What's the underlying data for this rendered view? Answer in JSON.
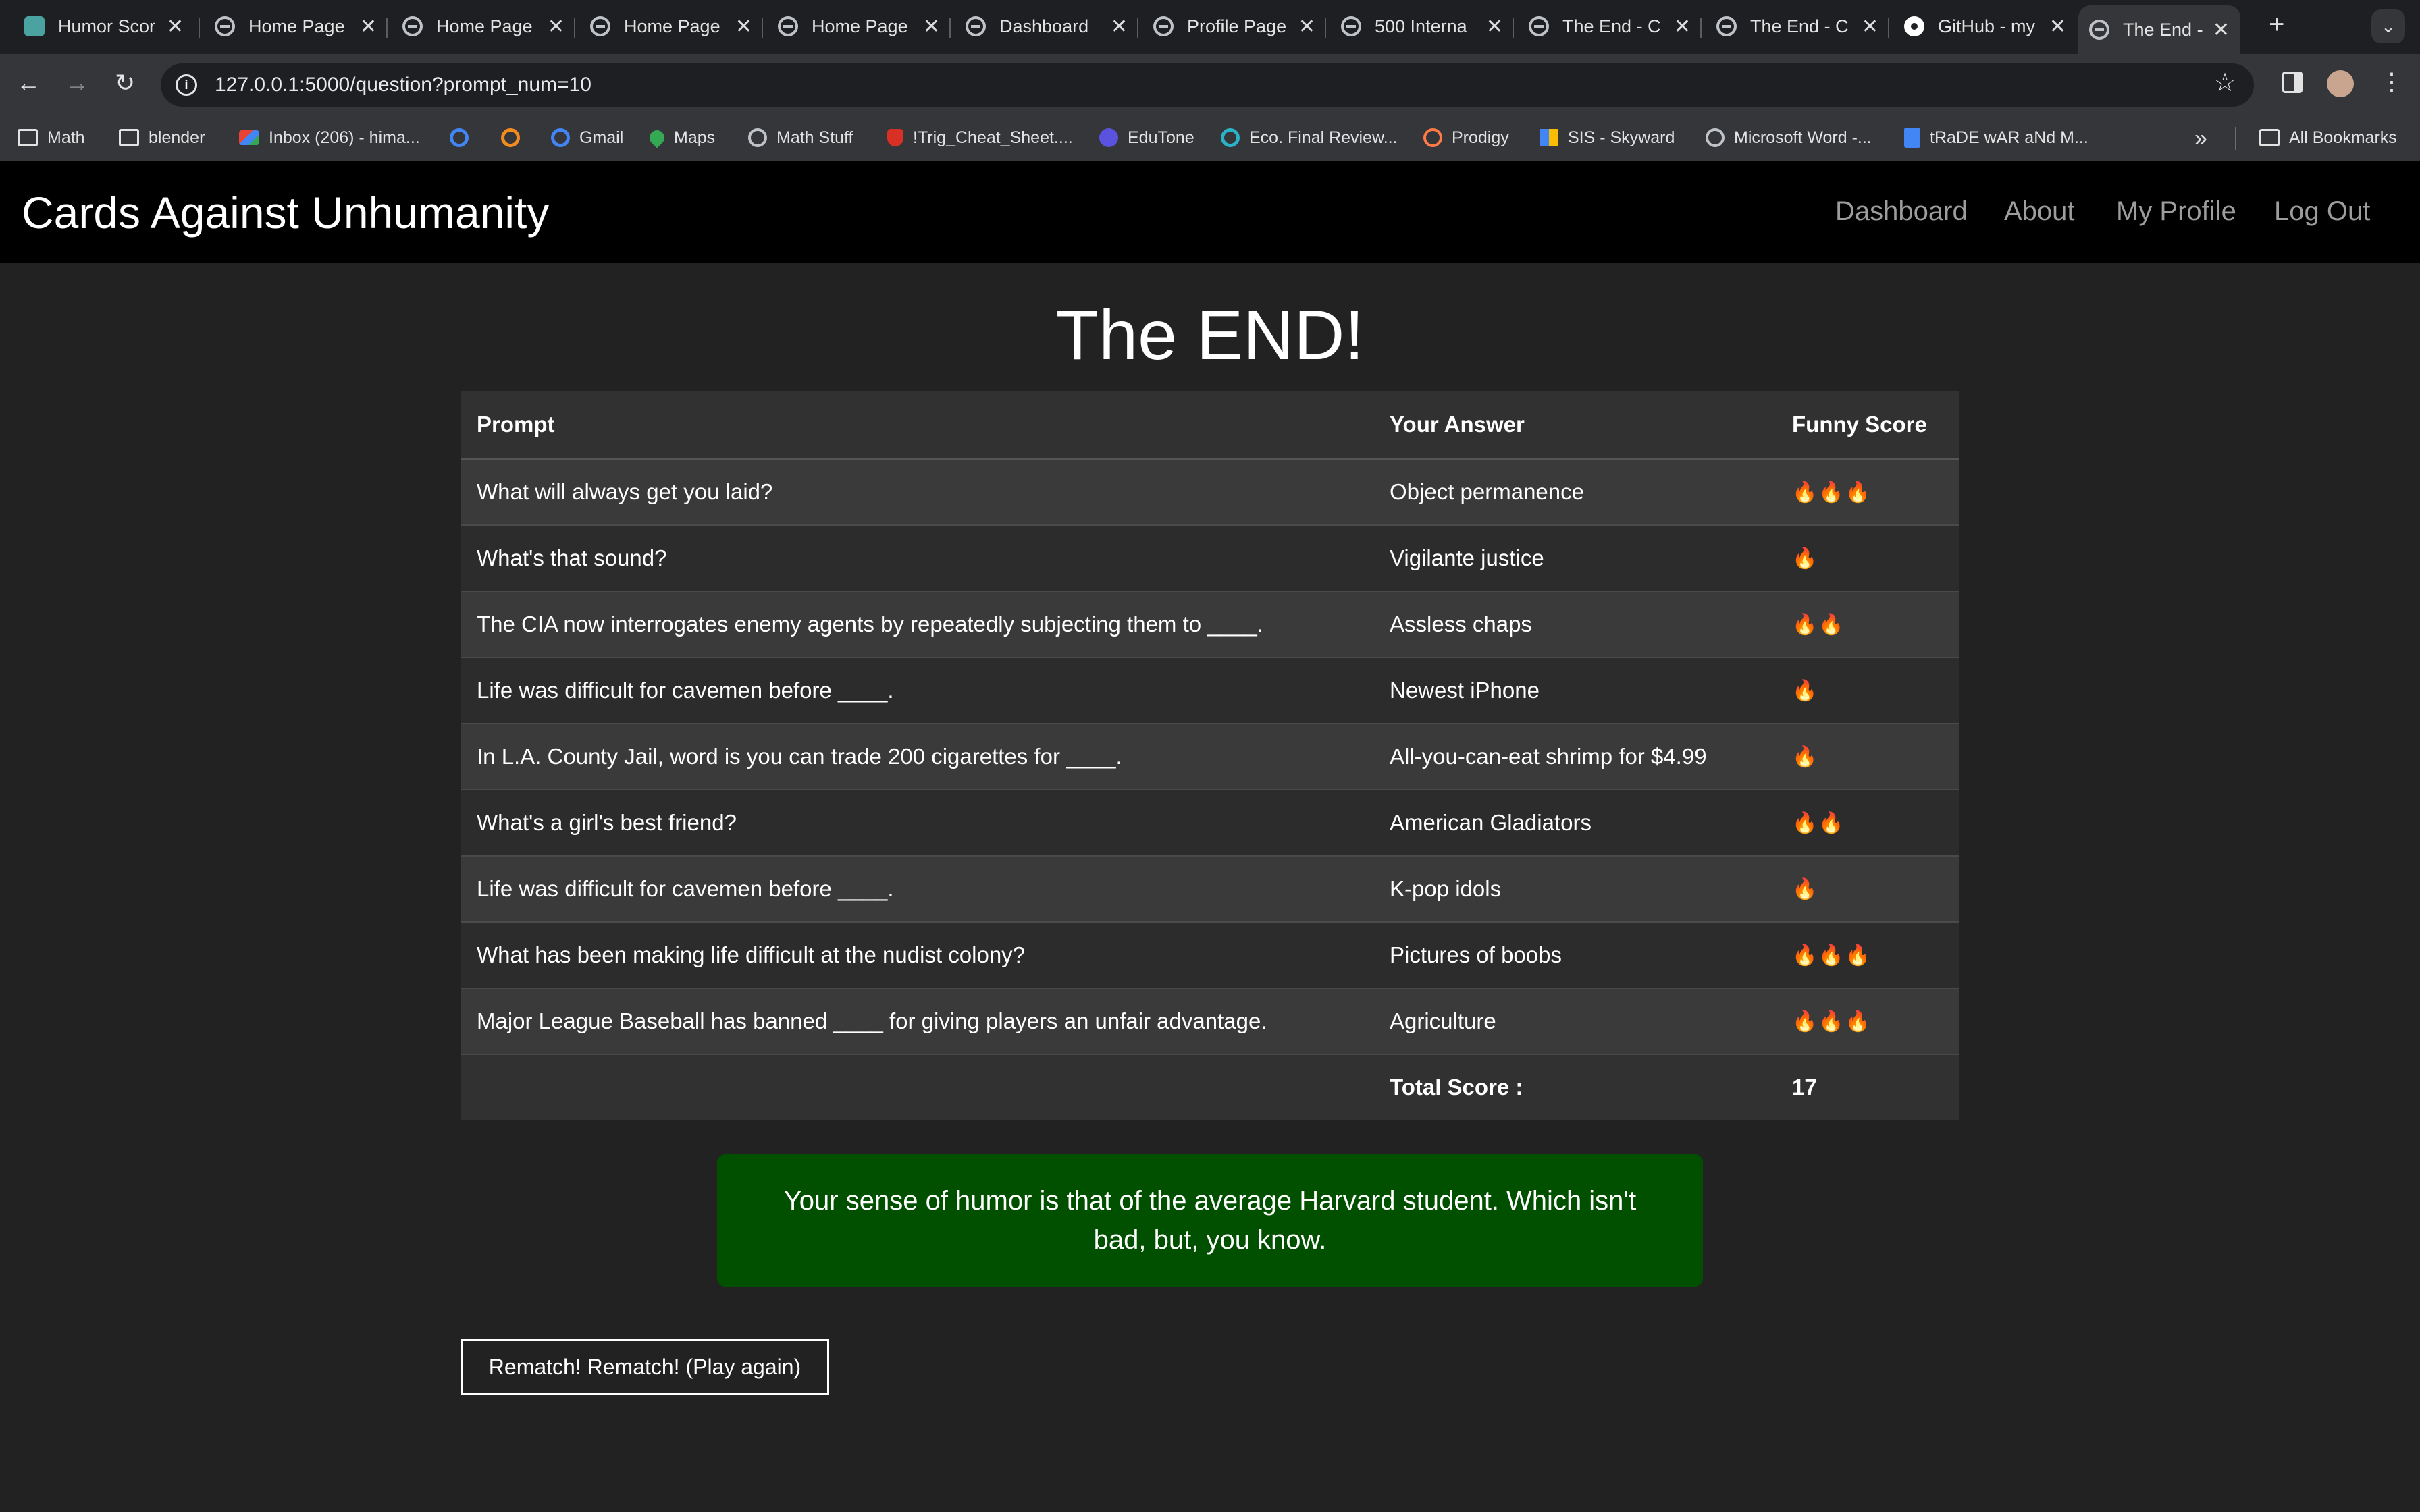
{
  "browser": {
    "tabs": [
      {
        "label": "Humor Scor",
        "icon": "site-icon",
        "active": false
      },
      {
        "label": "Home Page",
        "icon": "globe-icon",
        "active": false
      },
      {
        "label": "Home Page",
        "icon": "globe-icon",
        "active": false
      },
      {
        "label": "Home Page",
        "icon": "globe-icon",
        "active": false
      },
      {
        "label": "Home Page",
        "icon": "globe-icon",
        "active": false
      },
      {
        "label": "Dashboard",
        "icon": "globe-icon",
        "active": false
      },
      {
        "label": "Profile Page",
        "icon": "globe-icon",
        "active": false
      },
      {
        "label": "500 Interna",
        "icon": "globe-icon",
        "active": false
      },
      {
        "label": "The End - C",
        "icon": "globe-icon",
        "active": false
      },
      {
        "label": "The End - C",
        "icon": "globe-icon",
        "active": false
      },
      {
        "label": "GitHub - my",
        "icon": "github-icon",
        "active": false
      },
      {
        "label": "The End - C",
        "icon": "globe-icon",
        "active": true
      }
    ],
    "close_glyph": "✕",
    "url": "127.0.0.1:5000/question?prompt_num=10",
    "bookmarks": [
      {
        "label": "Math",
        "icon": "folder"
      },
      {
        "label": "blender",
        "icon": "folder"
      },
      {
        "label": "Inbox (206) - hima...",
        "icon": "gmail"
      },
      {
        "label": "",
        "icon": "g"
      },
      {
        "label": "",
        "icon": "orange"
      },
      {
        "label": "Gmail",
        "icon": "g"
      },
      {
        "label": "Maps",
        "icon": "maps"
      },
      {
        "label": "Math Stuff",
        "icon": "circle"
      },
      {
        "label": "!Trig_Cheat_Sheet....",
        "icon": "red"
      },
      {
        "label": "EduTone",
        "icon": "purple"
      },
      {
        "label": "Eco. Final Review...",
        "icon": "teal"
      },
      {
        "label": "Prodigy",
        "icon": "prodigy"
      },
      {
        "label": "SIS - Skyward",
        "icon": "sis"
      },
      {
        "label": "Microsoft Word -...",
        "icon": "circle"
      },
      {
        "label": "tRaDE wAR aNd M...",
        "icon": "doc"
      }
    ],
    "all_bookmarks": "All Bookmarks"
  },
  "site": {
    "brand": "Cards Against Unhumanity",
    "nav": [
      "Dashboard",
      "About",
      "My Profile",
      "Log Out"
    ]
  },
  "page": {
    "title": "The END!",
    "table": {
      "headers": [
        "Prompt",
        "Your Answer",
        "Funny Score"
      ],
      "rows": [
        {
          "prompt": "What will always get you laid?",
          "answer": "Object permanence",
          "score": "🔥🔥🔥"
        },
        {
          "prompt": "What's that sound?",
          "answer": "Vigilante justice",
          "score": "🔥"
        },
        {
          "prompt": "The CIA now interrogates enemy agents by repeatedly subjecting them to ____.",
          "answer": "Assless chaps",
          "score": "🔥🔥"
        },
        {
          "prompt": "Life was difficult for cavemen before ____.",
          "answer": "Newest iPhone",
          "score": "🔥"
        },
        {
          "prompt": "In L.A. County Jail, word is you can trade 200 cigarettes for ____.",
          "answer": "All-you-can-eat shrimp for $4.99",
          "score": "🔥"
        },
        {
          "prompt": "What's a girl's best friend?",
          "answer": "American Gladiators",
          "score": "🔥🔥"
        },
        {
          "prompt": "Life was difficult for cavemen before ____.",
          "answer": "K-pop idols",
          "score": "🔥"
        },
        {
          "prompt": "What has been making life difficult at the nudist colony?",
          "answer": "Pictures of boobs",
          "score": "🔥🔥🔥"
        },
        {
          "prompt": "Major League Baseball has banned ____ for giving players an unfair advantage.",
          "answer": "Agriculture",
          "score": "🔥🔥🔥"
        }
      ],
      "total_label": "Total Score :",
      "total_value": "17"
    },
    "verdict": "Your sense of humor is that of the average Harvard student. Which isn't bad, but, you know.",
    "rematch_label": "Rematch! Rematch! (Play again)"
  },
  "colors": {
    "page_bg": "#222222",
    "navbar_bg": "#000000",
    "verdict_bg": "#005000"
  }
}
